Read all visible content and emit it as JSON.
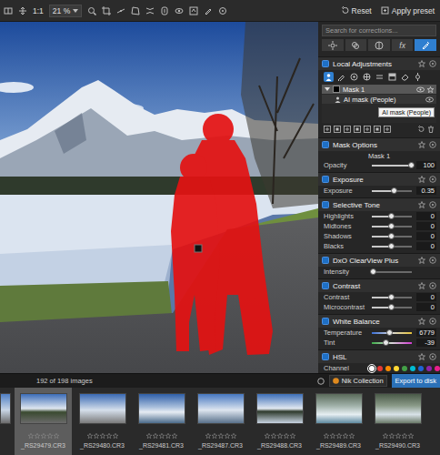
{
  "toolbar": {
    "zoom_ratio": "1:1",
    "zoom": "21 %",
    "reset": "Reset",
    "apply_preset": "Apply preset"
  },
  "panel": {
    "search": {
      "placeholder": "Search for corrections..."
    },
    "tabs": [
      {
        "selected": false
      },
      {
        "selected": false
      },
      {
        "selected": false
      },
      {
        "label": "fx",
        "selected": false
      },
      {
        "selected": true
      }
    ],
    "local_adjustments": {
      "title": "Local Adjustments",
      "tools": [
        {
          "selected": true
        },
        {
          "selected": false
        },
        {
          "selected": false
        },
        {
          "selected": false
        },
        {
          "selected": false
        },
        {
          "selected": false
        },
        {
          "selected": false
        },
        {
          "selected": false
        }
      ],
      "masks": [
        {
          "label": "Mask 1",
          "selected": true,
          "expanded": true,
          "layers": [
            {
              "label": "AI mask (People)",
              "selected": false
            }
          ]
        }
      ],
      "tooltip": "AI mask (People)"
    },
    "mask_options": {
      "title": "Mask Options",
      "mask_name": "Mask 1",
      "rows": [
        {
          "label": "Opacity",
          "value": "100",
          "level": 1.0,
          "kind": "slider"
        }
      ]
    },
    "sections": [
      {
        "title": "Exposure",
        "rows": [
          {
            "label": "Exposure",
            "value": "0.35",
            "level": 0.56,
            "kind": "slider"
          }
        ]
      },
      {
        "title": "Selective Tone",
        "rows": [
          {
            "label": "Highlights",
            "value": "0",
            "level": 0.5,
            "kind": "slider"
          },
          {
            "label": "Midtones",
            "value": "0",
            "level": 0.5,
            "kind": "slider"
          },
          {
            "label": "Shadows",
            "value": "0",
            "level": 0.5,
            "kind": "slider"
          },
          {
            "label": "Blacks",
            "value": "0",
            "level": 0.5,
            "kind": "slider"
          }
        ]
      },
      {
        "title": "DxO ClearView Plus",
        "rows": [
          {
            "label": "Intensity",
            "level": 0.04,
            "kind": "slider"
          }
        ]
      },
      {
        "title": "Contrast",
        "rows": [
          {
            "label": "Contrast",
            "value": "0",
            "level": 0.5,
            "kind": "slider"
          },
          {
            "label": "Microcontrast",
            "value": "0",
            "level": 0.5,
            "kind": "slider"
          }
        ]
      },
      {
        "title": "White Balance",
        "rows": [
          {
            "label": "Temperature",
            "value": "6779",
            "level": 0.45,
            "kind": "temperature"
          },
          {
            "label": "Tint",
            "value": "-39",
            "level": 0.36,
            "kind": "tint"
          }
        ]
      },
      {
        "title": "HSL",
        "rows": [
          {
            "label": "Channel",
            "kind": "channels",
            "dots": [
              {
                "color": "#ffffff",
                "selected": true
              },
              {
                "color": "#e53935",
                "selected": false
              },
              {
                "color": "#fb8c00",
                "selected": false
              },
              {
                "color": "#fdd835",
                "selected": false
              },
              {
                "color": "#43a047",
                "selected": false
              },
              {
                "color": "#00bcd4",
                "selected": false
              },
              {
                "color": "#1e63d6",
                "selected": false
              },
              {
                "color": "#8e24aa",
                "selected": false
              },
              {
                "color": "#e91e8c",
                "selected": false
              }
            ]
          }
        ]
      }
    ]
  },
  "filmstrip": {
    "count": "192 of 198 images",
    "nik": "Nik Collection",
    "export": "Export to disk",
    "thumbnails": [
      {
        "label": "_RS29479.CR3",
        "stars": 0,
        "selected": true
      },
      {
        "label": "_RS29480.CR3",
        "stars": 0,
        "selected": false
      },
      {
        "label": "_RS29481.CR3",
        "stars": 0,
        "selected": false
      },
      {
        "label": "_RS29487.CR3",
        "stars": 0,
        "selected": false
      },
      {
        "label": "_RS29488.CR3",
        "stars": 0,
        "selected": false
      },
      {
        "label": "_RS29489.CR3",
        "stars": 0,
        "selected": false
      },
      {
        "label": "_RS29490.CR3",
        "stars": 0,
        "selected": false
      }
    ]
  }
}
